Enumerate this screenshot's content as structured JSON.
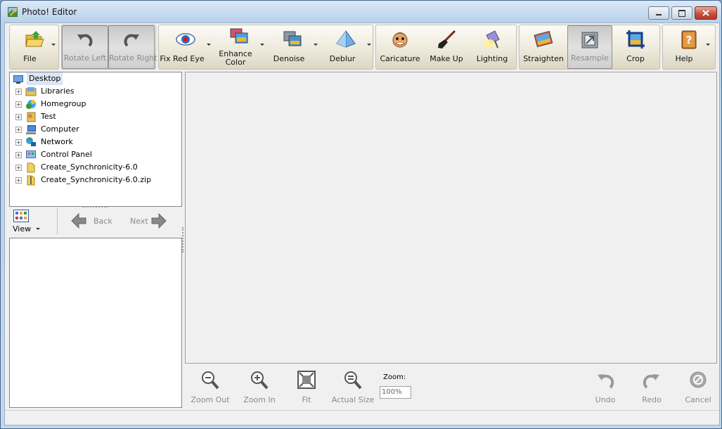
{
  "window": {
    "title": "Photo! Editor"
  },
  "toolbar": {
    "file": "File",
    "rotate_left": "Rotate Left",
    "rotate_right": "Rotate Right",
    "fix_red_eye": "Fix Red Eye",
    "enhance_color_1": "Enhance",
    "enhance_color_2": "Color",
    "denoise": "Denoise",
    "deblur": "Deblur",
    "caricature": "Caricature",
    "make_up": "Make Up",
    "lighting": "Lighting",
    "straighten": "Straighten",
    "resample": "Resample",
    "crop": "Crop",
    "help": "Help"
  },
  "tree": {
    "root": "Desktop",
    "items": [
      {
        "label": "Libraries",
        "icon": "libraries-icon"
      },
      {
        "label": "Homegroup",
        "icon": "homegroup-icon"
      },
      {
        "label": "Test",
        "icon": "user-folder-icon"
      },
      {
        "label": "Computer",
        "icon": "computer-icon"
      },
      {
        "label": "Network",
        "icon": "network-icon"
      },
      {
        "label": "Control Panel",
        "icon": "control-panel-icon"
      },
      {
        "label": "Create_Synchronicity-6.0",
        "icon": "folder-icon"
      },
      {
        "label": "Create_Synchronicity-6.0.zip",
        "icon": "zip-folder-icon"
      }
    ]
  },
  "nav": {
    "view": "View",
    "back": "Back",
    "next": "Next"
  },
  "bottom": {
    "zoom_out": "Zoom Out",
    "zoom_in": "Zoom In",
    "fit": "Fit",
    "actual_size": "Actual Size",
    "zoom_label": "Zoom:",
    "zoom_value": "100%",
    "undo": "Undo",
    "redo": "Redo",
    "cancel": "Cancel"
  }
}
